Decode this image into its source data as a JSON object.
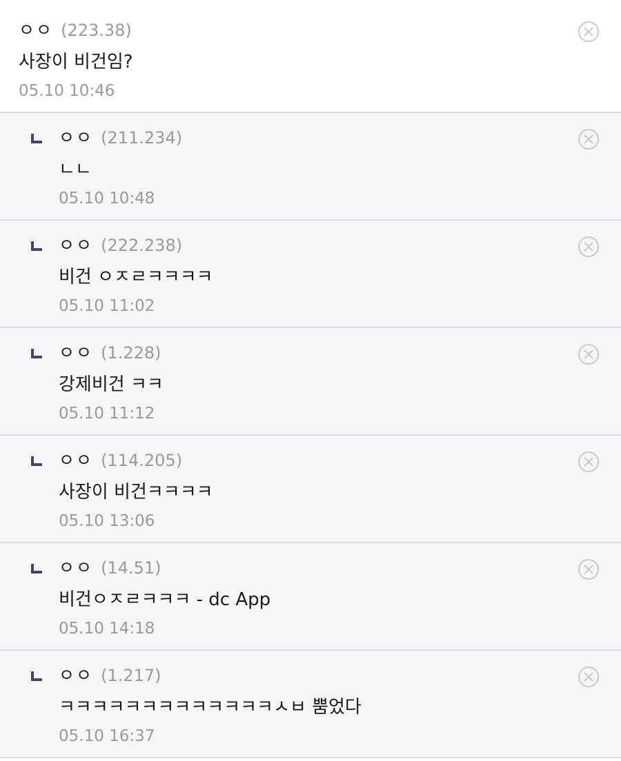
{
  "comments": [
    {
      "type": "main",
      "nick": "ㅇㅇ",
      "ip": "(223.38)",
      "text": "사장이 비건임?",
      "date": "05.10 10:46"
    },
    {
      "type": "reply",
      "nick": "ㅇㅇ",
      "ip": "(211.234)",
      "text": "ㄴㄴ",
      "date": "05.10 10:48"
    },
    {
      "type": "reply",
      "nick": "ㅇㅇ",
      "ip": "(222.238)",
      "text": "비건 ㅇㅈㄹㅋㅋㅋㅋ",
      "date": "05.10 11:02"
    },
    {
      "type": "reply",
      "nick": "ㅇㅇ",
      "ip": "(1.228)",
      "text": "강제비건 ㅋㅋ",
      "date": "05.10 11:12"
    },
    {
      "type": "reply",
      "nick": "ㅇㅇ",
      "ip": "(114.205)",
      "text": "사장이 비건ㅋㅋㅋㅋ",
      "date": "05.10 13:06"
    },
    {
      "type": "reply",
      "nick": "ㅇㅇ",
      "ip": "(14.51)",
      "text": "비건ㅇㅈㄹㅋㅋㅋ - dc App",
      "date": "05.10 14:18"
    },
    {
      "type": "reply",
      "nick": "ㅇㅇ",
      "ip": "(1.217)",
      "text": "ㅋㅋㅋㅋㅋㅋㅋㅋㅋㅋㅋㅋㅋㅅㅂ 뿜었다",
      "date": "05.10 16:37"
    }
  ],
  "icons": {
    "reply": "reply-arrow-icon",
    "delete": "delete-x-circle-icon"
  },
  "colors": {
    "reply_marker": "#3b4773",
    "reply_background": "#f5f6f9",
    "muted_text": "#9a9a9a",
    "divider": "#dcdde3"
  }
}
